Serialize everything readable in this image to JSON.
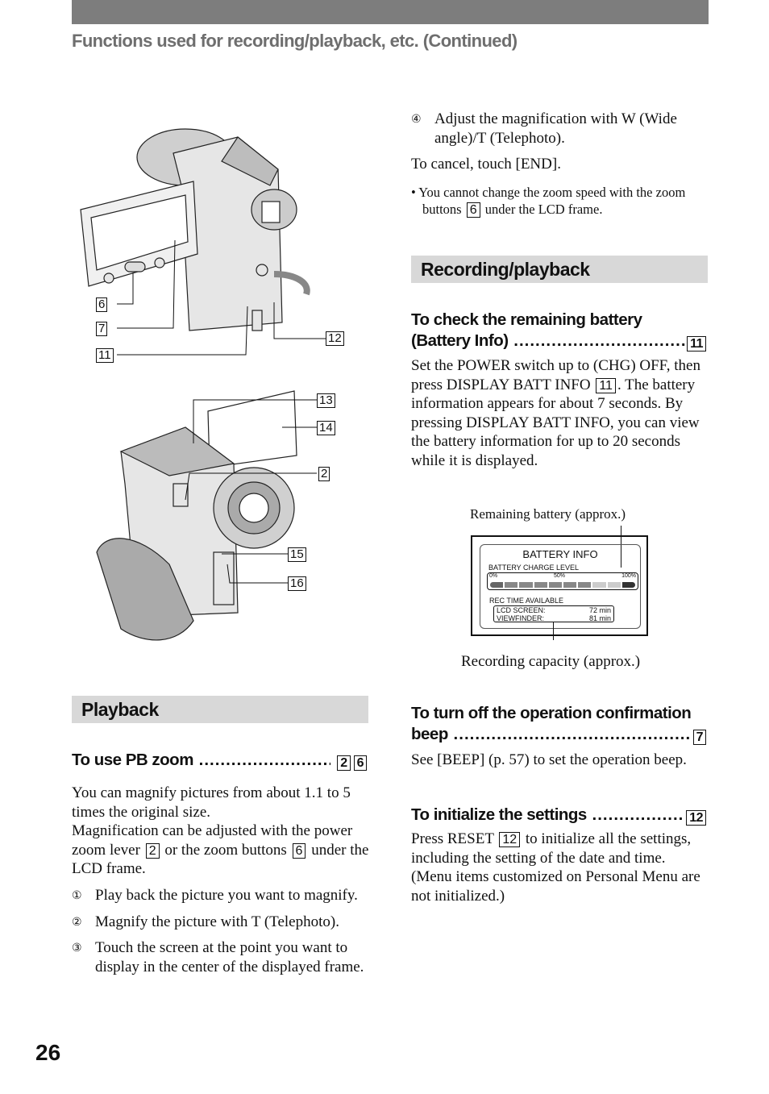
{
  "header": {
    "title": "Functions used for recording/playback, etc. (Continued)"
  },
  "figure_top": {
    "callouts": [
      "6",
      "7",
      "11",
      "12"
    ]
  },
  "figure_bottom": {
    "callouts": [
      "13",
      "14",
      "2",
      "15",
      "16"
    ]
  },
  "playback": {
    "section_title": "Playback",
    "pb_zoom": {
      "heading": "To use PB zoom",
      "refs": [
        "2",
        "6"
      ],
      "para1": "You can magnify pictures from about 1.1 to 5 times the original size.",
      "para2a": "Magnification can be adjusted with the power zoom lever",
      "para2b": "or the zoom buttons",
      "para2c": "under the LCD frame.",
      "steps": [
        {
          "num": "①",
          "text": "Play back the picture you want to magnify."
        },
        {
          "num": "②",
          "text": "Magnify the picture with T (Telephoto)."
        },
        {
          "num": "③",
          "text": "Touch the screen at the point you want to display in the center of the displayed frame."
        },
        {
          "num": "④",
          "text": "Adjust the magnification with W (Wide angle)/T (Telephoto)."
        }
      ],
      "cancel": "To cancel, touch [END].",
      "note_a": "• You cannot change the zoom speed with the zoom buttons",
      "note_b": "under the LCD frame."
    }
  },
  "recording": {
    "section_title": "Recording/playback",
    "battery": {
      "heading1": "To check the remaining battery",
      "heading2": "(Battery Info)",
      "ref": "11",
      "text_a": "Set the POWER switch up to (CHG) OFF, then press DISPLAY BATT INFO",
      "text_b": ". The battery information appears for about 7 seconds. By pressing DISPLAY BATT INFO, you can view the battery information for up to 20 seconds while it is displayed.",
      "caption_top": "Remaining battery (approx.)",
      "caption_bottom": "Recording capacity (approx.)",
      "screen": {
        "title": "BATTERY INFO",
        "charge_label": "BATTERY CHARGE LEVEL",
        "scale": [
          "0%",
          "50%",
          "100%"
        ],
        "level_percent": 70,
        "rec_label": "REC TIME AVAILABLE",
        "lcd_label": "LCD SCREEN:",
        "lcd_value": "72 min",
        "vf_label": "VIEWFINDER:",
        "vf_value": "81 min"
      }
    },
    "beep": {
      "heading1": "To turn off the operation confirmation",
      "heading2": "beep",
      "ref": "7",
      "text": "See [BEEP] (p. 57) to set the operation beep."
    },
    "init": {
      "heading": "To initialize the settings",
      "ref": "12",
      "text_a": "Press RESET",
      "text_b": "to initialize all the settings, including the setting of the date and time.",
      "text_c": "(Menu items customized on Personal Menu are not initialized.)"
    }
  },
  "page_number": "26"
}
